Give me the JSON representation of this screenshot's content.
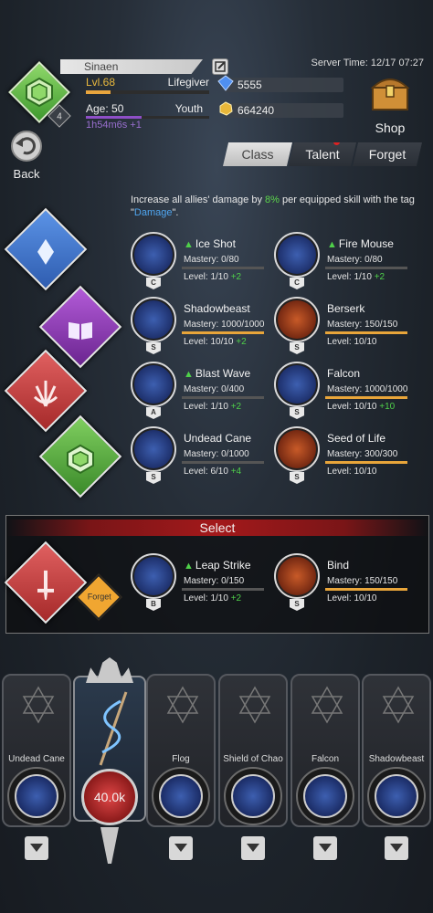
{
  "player": {
    "name": "Sinaen",
    "level": "Lvl.68",
    "class": "Lifegiver",
    "level_progress": 0.2,
    "age": "Age: 50",
    "phase": "Youth",
    "age_progress": 0.45,
    "age_timer": "1h54m6s +1",
    "rank_badge": "4"
  },
  "server_time": "Server Time: 12/17 07:27",
  "resources": {
    "gems": "5555",
    "gold": "664240"
  },
  "shop_label": "Shop",
  "back_label": "Back",
  "tabs": [
    "Class",
    "Talent",
    "Forget"
  ],
  "bonus": {
    "pre": "Increase all allies' damage by ",
    "pct": "8%",
    "mid": " per equipped skill with the tag \"",
    "tag": "Damage",
    "post": "\"."
  },
  "skills": [
    {
      "name": "Ice Shot",
      "upgrade": true,
      "mastery": "Mastery: 0/80",
      "mastery_frac": 0.0,
      "level": "Level: 1/10",
      "bonus": "+2",
      "grade": "C",
      "theme": "ice"
    },
    {
      "name": "Fire Mouse",
      "upgrade": true,
      "mastery": "Mastery: 0/80",
      "mastery_frac": 0.0,
      "level": "Level: 1/10",
      "bonus": "+2",
      "grade": "C",
      "theme": "ice"
    },
    {
      "name": "Shadowbeast",
      "upgrade": false,
      "mastery": "Mastery: 1000/1000",
      "mastery_frac": 1.0,
      "level": "Level: 10/10",
      "bonus": "+2",
      "grade": "S",
      "theme": "ice"
    },
    {
      "name": "Berserk",
      "upgrade": false,
      "mastery": "Mastery: 150/150",
      "mastery_frac": 1.0,
      "level": "Level: 10/10",
      "bonus": "",
      "grade": "S",
      "theme": "fire"
    },
    {
      "name": "Blast Wave",
      "upgrade": true,
      "mastery": "Mastery: 0/400",
      "mastery_frac": 0.0,
      "level": "Level: 1/10",
      "bonus": "+2",
      "grade": "A",
      "theme": "ice"
    },
    {
      "name": "Falcon",
      "upgrade": false,
      "mastery": "Mastery: 1000/1000",
      "mastery_frac": 1.0,
      "level": "Level: 10/10",
      "bonus": "+10",
      "grade": "S",
      "theme": "ice"
    },
    {
      "name": "Undead Cane",
      "upgrade": false,
      "mastery": "Mastery: 0/1000",
      "mastery_frac": 0.0,
      "level": "Level: 6/10",
      "bonus": "+4",
      "grade": "S",
      "theme": "ice"
    },
    {
      "name": "Seed of Life",
      "upgrade": false,
      "mastery": "Mastery: 300/300",
      "mastery_frac": 1.0,
      "level": "Level: 10/10",
      "bonus": "",
      "grade": "S",
      "theme": "fire"
    }
  ],
  "select": {
    "title": "Select",
    "forget_label": "Forget",
    "skills": [
      {
        "name": "Leap Strike",
        "upgrade": true,
        "mastery": "Mastery: 0/150",
        "mastery_frac": 0.0,
        "level": "Level: 1/10",
        "bonus": "+2",
        "grade": "B",
        "theme": "ice"
      },
      {
        "name": "Bind",
        "upgrade": false,
        "mastery": "Mastery: 150/150",
        "mastery_frac": 1.0,
        "level": "Level: 10/10",
        "bonus": "",
        "grade": "S",
        "theme": "fire"
      }
    ]
  },
  "skillbar": {
    "center_value": "40.0k",
    "slots": [
      "Undead Cane",
      "Flog",
      "Shield of Chao",
      "Falcon",
      "Shadowbeast"
    ]
  },
  "colors": {
    "class_blue": "#3b72c9",
    "class_purple": "#8a3bb8",
    "class_red": "#c94040",
    "class_green": "#4d9d3a",
    "accent_orange": "#e8a53a",
    "bonus_green": "#4fd04a"
  }
}
